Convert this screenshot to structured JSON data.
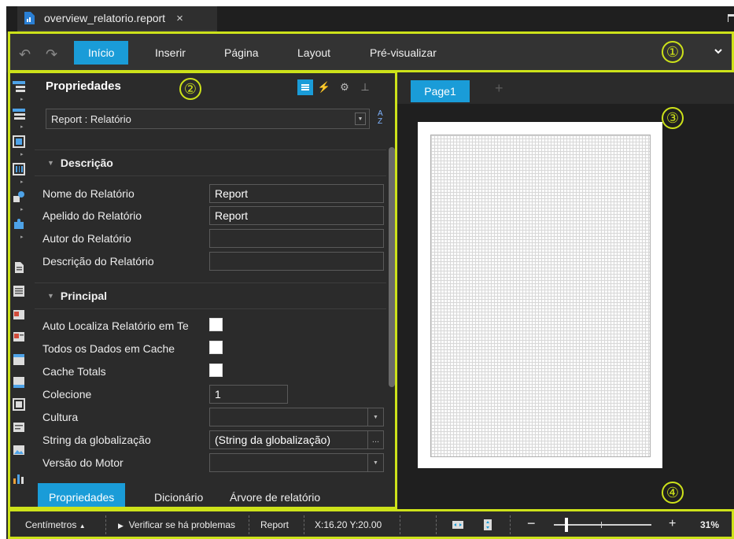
{
  "file_tab": {
    "name": "overview_relatorio.report",
    "close": "×"
  },
  "ribbon": {
    "tabs": [
      "Início",
      "Inserir",
      "Página",
      "Layout",
      "Pré-visualizar"
    ],
    "active_tab": "Início"
  },
  "callouts": [
    "①",
    "②",
    "③",
    "④"
  ],
  "properties": {
    "title": "Propriedades",
    "object_selector": "Report : Relatório",
    "sections": [
      {
        "label": "Descrição",
        "rows": [
          {
            "label": "Nome do Relatório",
            "value": "Report"
          },
          {
            "label": "Apelido do Relatório",
            "value": "Report"
          },
          {
            "label": "Autor do Relatório",
            "value": ""
          },
          {
            "label": "Descrição do Relatório",
            "value": ""
          }
        ]
      },
      {
        "label": "Principal",
        "rows": [
          {
            "label": "Auto Localiza Relatório em Te",
            "checked": false
          },
          {
            "label": "Todos os Dados em Cache",
            "checked": false
          },
          {
            "label": "Cache Totals",
            "checked": false
          },
          {
            "label": "Colecione",
            "value": "1"
          },
          {
            "label": "Cultura",
            "value": ""
          },
          {
            "label": "String da globalização",
            "value": "(String da globalização)",
            "button": "..."
          },
          {
            "label": "Versão do Motor",
            "value": ""
          }
        ]
      }
    ],
    "bottom_tabs": [
      "Propriedades",
      "Dicionário",
      "Árvore de relatório"
    ]
  },
  "canvas": {
    "page_tab": "Page1",
    "add_page": "+"
  },
  "status": {
    "units": "Centímetros",
    "check_issues": "Verificar se há problemas",
    "report": "Report",
    "coords": "X:16.20 Y:20.00",
    "zoom": "31%",
    "zoom_level": 0.31,
    "minus": "−",
    "plus": "+"
  },
  "colors": {
    "accent": "#1a9cd8",
    "callout": "#cde21a",
    "panel": "#2b2b2b"
  }
}
